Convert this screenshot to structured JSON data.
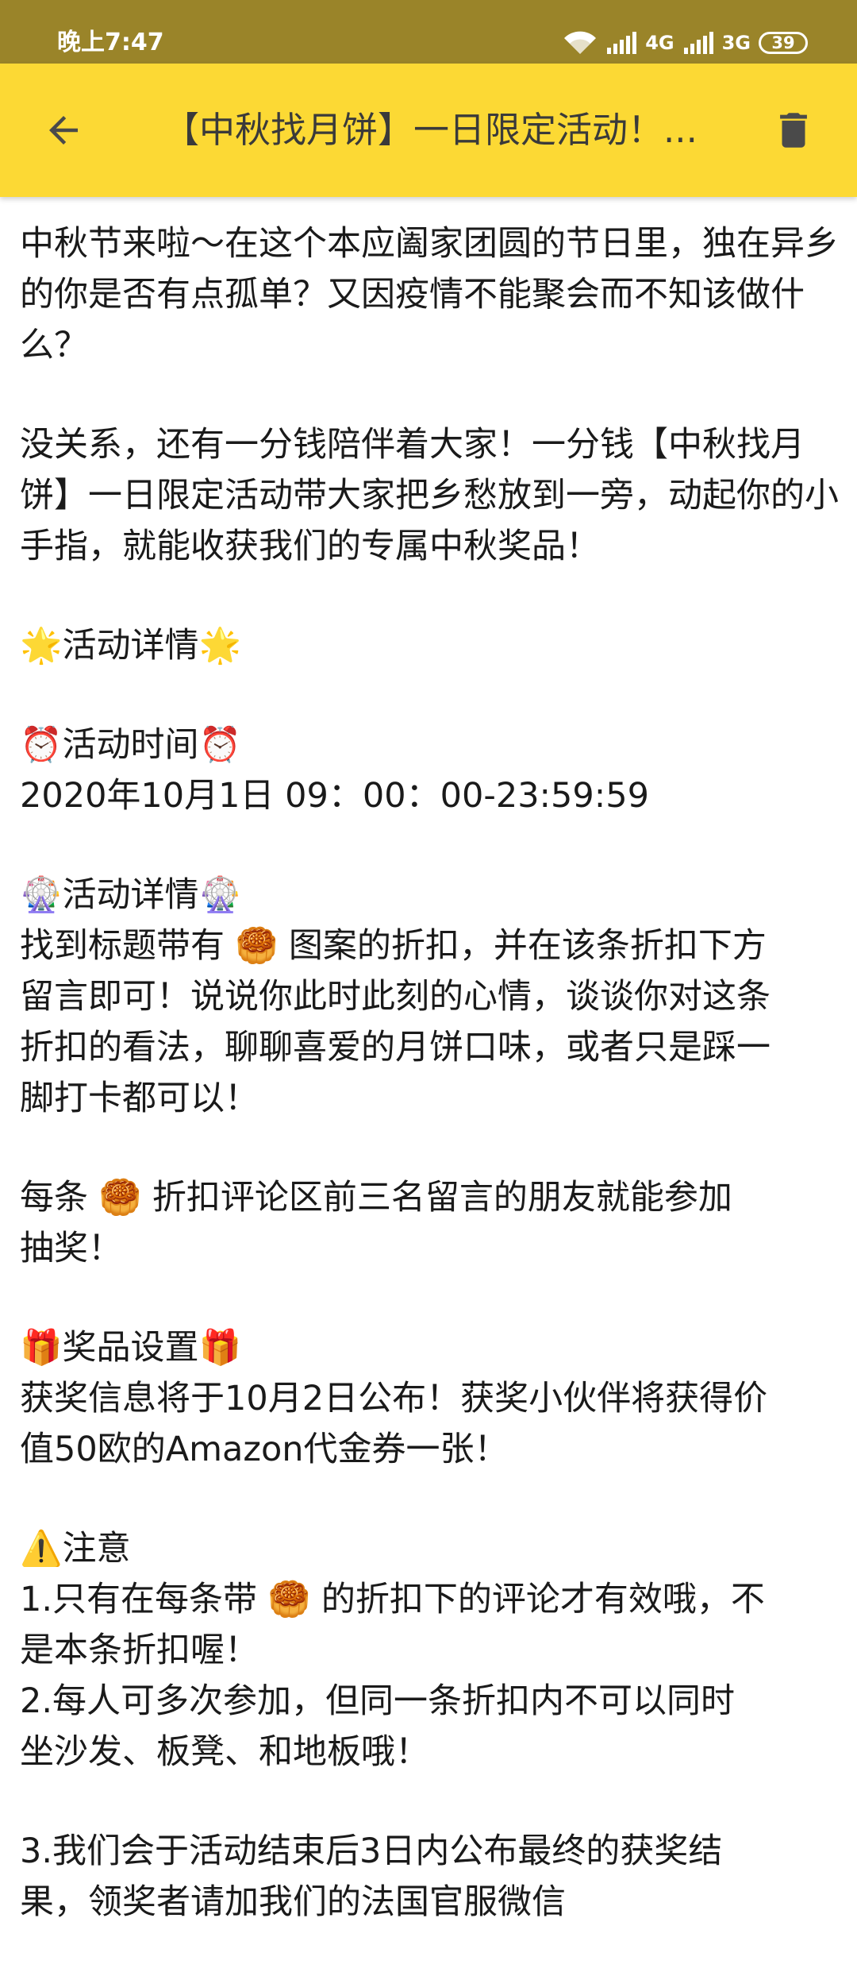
{
  "status_bar": {
    "time": "晚上7:47",
    "network_1": "4G",
    "network_2": "3G",
    "battery": "39"
  },
  "app_bar": {
    "title": "【中秋找月饼】一日限定活动！..."
  },
  "content": {
    "intro": "中秋节来啦～在这个本应阖家团圆的节日里，独在异乡的你是否有点孤单？又因疫情不能聚会而不知该做什么？",
    "intro_2": "没关系，还有一分钱陪伴着大家！一分钱【中秋找月饼】一日限定活动带大家把乡愁放到一旁，动起你的小手指，就能收获我们的专属中秋奖品！",
    "details_heading": "活动详情",
    "time_heading": "活动时间",
    "time_value": "2020年10月1日 09：00：00-23:59:59",
    "details2_heading": "活动详情",
    "find_text_a": "找到标题带有",
    "find_text_b": "图案的折扣，并在该条折扣下方",
    "find_text_c": "留言即可！说说你此时此刻的心情，谈谈你对这条",
    "find_text_d": "折扣的看法，聊聊喜爱的月饼口味，或者只是踩一",
    "find_text_e": "脚打卡都可以！",
    "each_a": "每条",
    "each_b": "折扣评论区前三名留言的朋友就能参加",
    "each_c": "抽奖！",
    "prize_heading": "奖品设置",
    "prize_line_1": "获奖信息将于10月2日公布！获奖小伙伴将获得价",
    "prize_line_2": "值50欧的Amazon代金券一张！",
    "note_heading": "注意",
    "note1_a": "1.只有在每条带",
    "note1_b": "的折扣下的评论才有效哦，不",
    "note1_c": "是本条折扣喔！",
    "note2_a": "2.每人可多次参加，但同一条折扣内不可以同时",
    "note2_b": "坐沙发、板凳、和地板哦！",
    "note3_a": "3.我们会于活动结束后3日内公布最终的获奖结",
    "note3_b": "果，领奖者请加我们的法国官服微信"
  },
  "icons": {
    "star": "star-icon",
    "clock": "alarm-clock-icon",
    "wheel": "ferris-wheel-icon",
    "mooncake": "mooncake-icon",
    "gift": "gift-icon",
    "warning": "warning-icon"
  },
  "colors": {
    "status_bar": "#9a8429",
    "app_bar": "#fcd934",
    "icon": "#4a4a4a"
  }
}
